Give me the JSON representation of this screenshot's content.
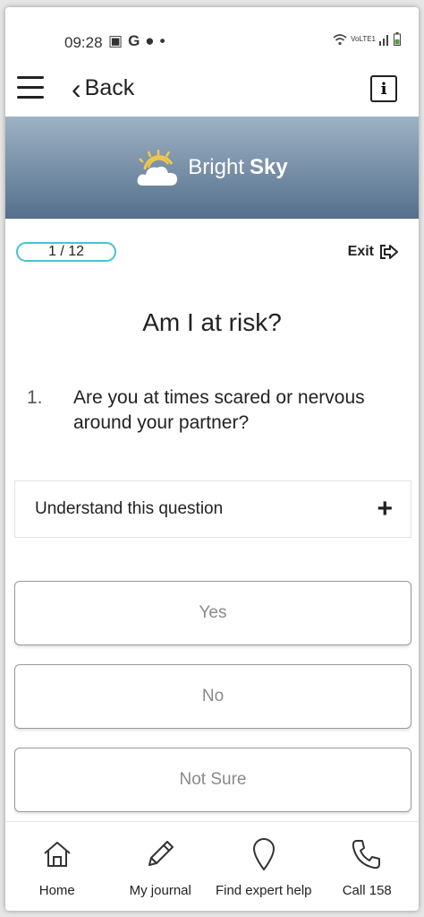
{
  "status": {
    "time": "09:28",
    "left_icons": [
      "gallery-icon",
      "google-icon",
      "account-icon",
      "dot-icon"
    ],
    "left_icon_glyphs": [
      "▣",
      "G",
      "●",
      "•"
    ],
    "right_text": "VoLTE1",
    "right_icons": [
      "wifi-icon",
      "signal-icon",
      "battery-icon"
    ]
  },
  "topbar": {
    "back_label": "Back",
    "back_icon": "‹",
    "info_icon": "i"
  },
  "banner": {
    "brand_light": "Bright",
    "brand_bold": "Sky",
    "colors": {
      "top": "#9eb2c5",
      "bottom": "#55708c"
    }
  },
  "progress": {
    "label": "1 / 12",
    "current": 1,
    "total": 12,
    "accent": "#49c3cf"
  },
  "exit": {
    "label": "Exit"
  },
  "page": {
    "title": "Am I at risk?"
  },
  "question": {
    "number": "1.",
    "text": "Are you at times scared or nervous around your partner?"
  },
  "accordion": {
    "label": "Understand this question",
    "icon": "+"
  },
  "answers": [
    {
      "label": "Yes"
    },
    {
      "label": "No"
    },
    {
      "label": "Not Sure"
    }
  ],
  "bottom_nav": [
    {
      "label": "Home",
      "icon": "home-icon"
    },
    {
      "label": "My journal",
      "icon": "pencil-icon"
    },
    {
      "label": "Find expert help",
      "icon": "location-pin-icon"
    },
    {
      "label": "Call 158",
      "icon": "phone-icon"
    }
  ]
}
